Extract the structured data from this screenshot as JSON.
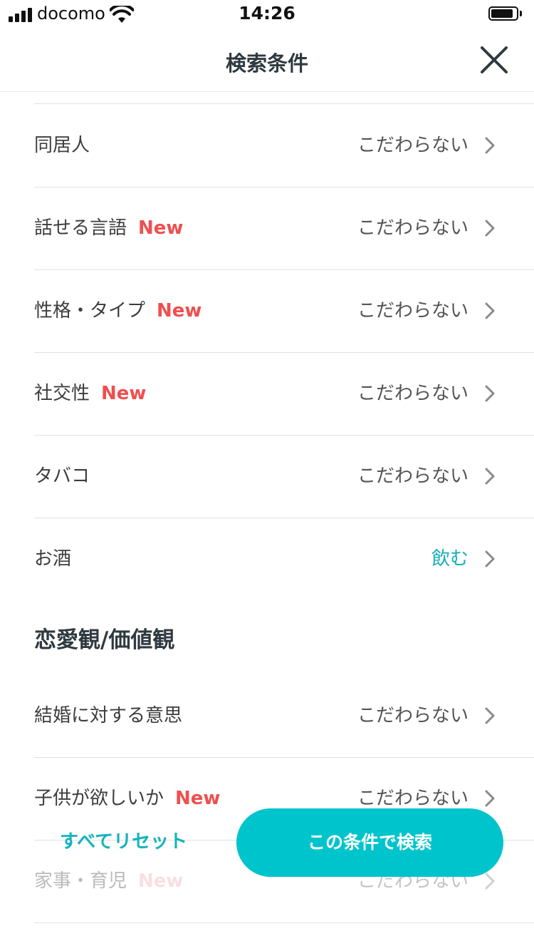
{
  "status_bar": {
    "carrier": "docomo",
    "time": "14:26"
  },
  "nav": {
    "title": "検索条件",
    "close_icon": "close-icon"
  },
  "rows_group1": [
    {
      "label": "同居人",
      "badge": "",
      "value": "こだわらない"
    },
    {
      "label": "話せる言語",
      "badge": "New",
      "value": "こだわらない"
    },
    {
      "label": "性格・タイプ",
      "badge": "New",
      "value": "こだわらない"
    },
    {
      "label": "社交性",
      "badge": "New",
      "value": "こだわらない"
    },
    {
      "label": "タバコ",
      "badge": "",
      "value": "こだわらない"
    },
    {
      "label": "お酒",
      "badge": "",
      "value": "飲む"
    }
  ],
  "section_title": "恋愛観/価値観",
  "rows_group2": [
    {
      "label": "結婚に対する意思",
      "badge": "",
      "value": "こだわらない"
    },
    {
      "label": "子供が欲しいか",
      "badge": "New",
      "value": "こだわらない"
    },
    {
      "label": "家事・育児",
      "badge": "New",
      "value": "こだわらない"
    }
  ],
  "footer": {
    "reset_label": "すべてリセット",
    "search_label": "この条件で検索"
  },
  "colors": {
    "accent": "#00c4cc",
    "accent_text": "#17aeb9",
    "new_badge": "#ef4f4f"
  }
}
